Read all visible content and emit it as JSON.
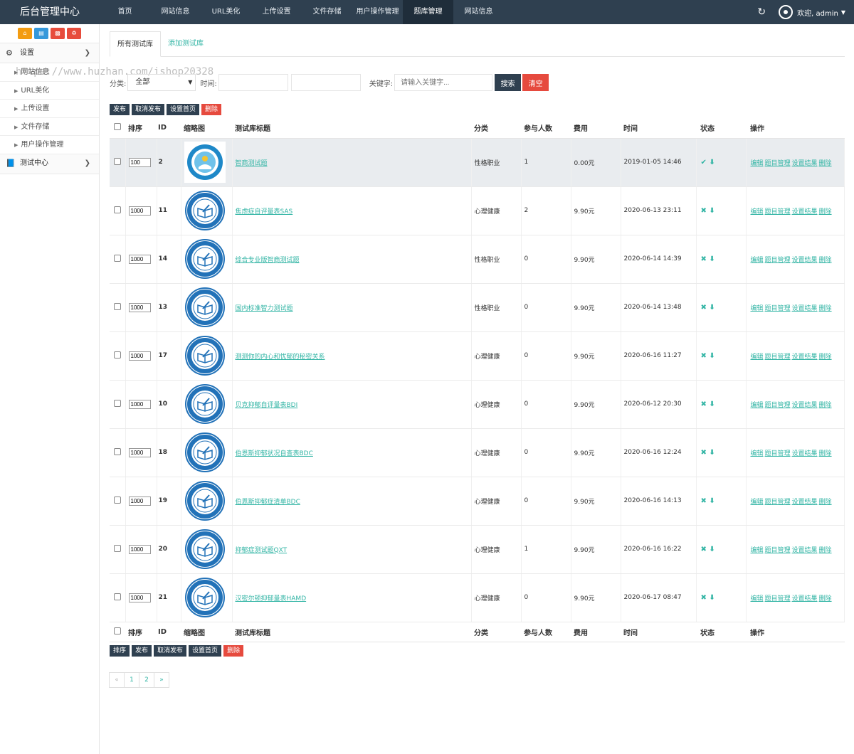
{
  "header": {
    "brand": "后台管理中心",
    "nav": [
      {
        "label": "首页",
        "active": false
      },
      {
        "label": "网站信息",
        "active": false
      },
      {
        "label": "URL美化",
        "active": false
      },
      {
        "label": "上传设置",
        "active": false
      },
      {
        "label": "文件存储",
        "active": false
      },
      {
        "label": "用户操作管理",
        "active": false
      },
      {
        "label": "题库管理",
        "active": true
      },
      {
        "label": "网站信息",
        "active": false
      }
    ],
    "welcome": "欢迎, admin",
    "refresh_icon": "refresh-icon",
    "avatar_icon": "user-avatar-icon"
  },
  "sidebar": {
    "tools": [
      {
        "icon": "home-icon",
        "color": "#f39c12"
      },
      {
        "icon": "document-icon",
        "color": "#3498db"
      },
      {
        "icon": "trash-icon",
        "color": "#e74c3c"
      },
      {
        "icon": "recycle-icon",
        "color": "#e74c3c"
      }
    ],
    "settings": {
      "label": "设置",
      "icon": "cogs-icon"
    },
    "settings_items": [
      {
        "label": "网站信息"
      },
      {
        "label": "URL美化"
      },
      {
        "label": "上传设置"
      },
      {
        "label": "文件存储"
      },
      {
        "label": "用户操作管理"
      }
    ],
    "test_center": {
      "label": "测试中心",
      "icon": "book-icon"
    }
  },
  "watermark": "https://www.huzhan.com/ishop20328",
  "tabs": [
    {
      "label": "所有测试库",
      "active": true
    },
    {
      "label": "添加测试库",
      "active": false
    }
  ],
  "filter": {
    "category_label": "分类:",
    "category_value": "全部",
    "time_label": "时间:",
    "keyword_label": "关键字:",
    "keyword_placeholder": "请输入关键字...",
    "search_label": "搜索",
    "clear_label": "清空"
  },
  "top_actions": [
    "发布",
    "取消发布",
    "设置首页",
    "删除"
  ],
  "bottom_actions": [
    "排序",
    "发布",
    "取消发布",
    "设置首页",
    "删除"
  ],
  "columns": [
    "排序",
    "ID",
    "缩略图",
    "测试库标题",
    "分类",
    "参与人数",
    "费用",
    "时间",
    "状态",
    "操作"
  ],
  "row_ops": [
    "编辑",
    "题目管理",
    "设置结果",
    "删除"
  ],
  "rows": [
    {
      "order": "100",
      "id": "2",
      "title": "智商测试题",
      "category": "性格职业",
      "participants": "1",
      "fee": "0.00元",
      "time": "2019-01-05 14:46",
      "status_icon": "check-icon",
      "status": "✔",
      "home_icon": "arrow-down-icon",
      "thumb": "logo",
      "highlight": true
    },
    {
      "order": "1000",
      "id": "11",
      "title": "焦虑症自评量表SAS",
      "category": "心理健康",
      "participants": "2",
      "fee": "9.90元",
      "time": "2020-06-13 23:11",
      "status_icon": "cross-icon",
      "status": "✖",
      "home_icon": "arrow-down-icon",
      "thumb": "seal",
      "highlight": false
    },
    {
      "order": "1000",
      "id": "14",
      "title": "综合专业版智商测试题",
      "category": "性格职业",
      "participants": "0",
      "fee": "9.90元",
      "time": "2020-06-14 14:39",
      "status_icon": "cross-icon",
      "status": "✖",
      "home_icon": "arrow-down-icon",
      "thumb": "seal",
      "highlight": false
    },
    {
      "order": "1000",
      "id": "13",
      "title": "国内标准智力测试题",
      "category": "性格职业",
      "participants": "0",
      "fee": "9.90元",
      "time": "2020-06-14 13:48",
      "status_icon": "cross-icon",
      "status": "✖",
      "home_icon": "arrow-down-icon",
      "thumb": "seal",
      "highlight": false
    },
    {
      "order": "1000",
      "id": "17",
      "title": "测测你的内心和忧郁的秘密关系",
      "category": "心理健康",
      "participants": "0",
      "fee": "9.90元",
      "time": "2020-06-16 11:27",
      "status_icon": "cross-icon",
      "status": "✖",
      "home_icon": "arrow-down-icon",
      "thumb": "seal",
      "highlight": false
    },
    {
      "order": "1000",
      "id": "10",
      "title": "贝克抑郁自评量表BDI",
      "category": "心理健康",
      "participants": "0",
      "fee": "9.90元",
      "time": "2020-06-12 20:30",
      "status_icon": "cross-icon",
      "status": "✖",
      "home_icon": "arrow-down-icon",
      "thumb": "seal",
      "highlight": false
    },
    {
      "order": "1000",
      "id": "18",
      "title": "伯恩斯抑郁状况自查表BDC",
      "category": "心理健康",
      "participants": "0",
      "fee": "9.90元",
      "time": "2020-06-16 12:24",
      "status_icon": "cross-icon",
      "status": "✖",
      "home_icon": "arrow-down-icon",
      "thumb": "seal",
      "highlight": false
    },
    {
      "order": "1000",
      "id": "19",
      "title": "伯恩斯抑郁症清单BDC",
      "category": "心理健康",
      "participants": "0",
      "fee": "9.90元",
      "time": "2020-06-16 14:13",
      "status_icon": "cross-icon",
      "status": "✖",
      "home_icon": "arrow-down-icon",
      "thumb": "seal",
      "highlight": false
    },
    {
      "order": "1000",
      "id": "20",
      "title": "抑郁症测试题QXT",
      "category": "心理健康",
      "participants": "1",
      "fee": "9.90元",
      "time": "2020-06-16 16:22",
      "status_icon": "cross-icon",
      "status": "✖",
      "home_icon": "arrow-down-icon",
      "thumb": "seal",
      "highlight": false
    },
    {
      "order": "1000",
      "id": "21",
      "title": "汉密尔顿抑郁量表HAMD",
      "category": "心理健康",
      "participants": "0",
      "fee": "9.90元",
      "time": "2020-06-17 08:47",
      "status_icon": "cross-icon",
      "status": "✖",
      "home_icon": "arrow-down-icon",
      "thumb": "seal",
      "highlight": false
    }
  ],
  "pagination": [
    "«",
    "1",
    "2",
    "»"
  ],
  "colors": {
    "header_bg": "#2f4050",
    "accent": "#33b5a5",
    "danger": "#e64a3e"
  }
}
